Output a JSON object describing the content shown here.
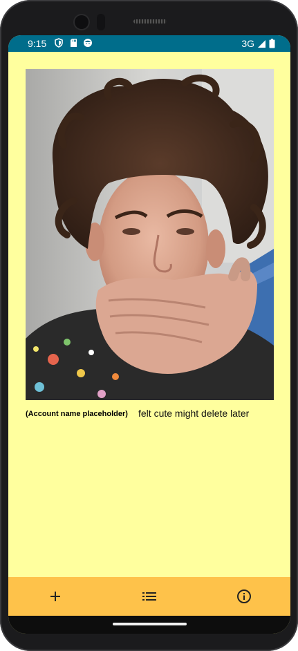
{
  "status_bar": {
    "time": "9:15",
    "network": "3G",
    "left_icons": [
      "shield-icon",
      "sd-card-icon",
      "face-icon"
    ],
    "right_icons": [
      "signal-icon",
      "battery-icon"
    ]
  },
  "post": {
    "image_icon": "selfie-photo",
    "account_name": "(Account name placeholder)",
    "caption": "felt cute might delete later"
  },
  "bottom_nav": {
    "items": [
      {
        "icon": "plus-icon"
      },
      {
        "icon": "list-icon"
      },
      {
        "icon": "info-icon"
      }
    ]
  },
  "colors": {
    "status_bar": "#006d8b",
    "background": "#ffff9e",
    "bottom_nav": "#fec24a"
  }
}
